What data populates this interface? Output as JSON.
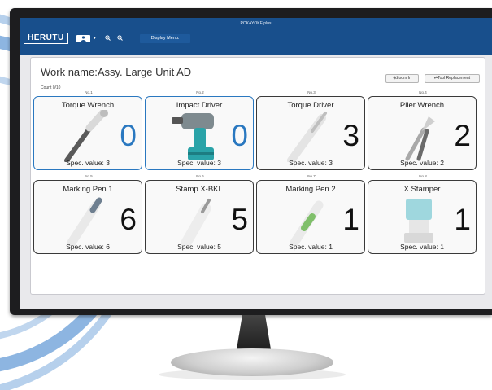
{
  "app": {
    "title": "POKAYOKE plus",
    "logo": "HERUTU"
  },
  "toolbar": {
    "user_icon": "user-icon",
    "caret": "▼",
    "zoom_in_glyph": "⊕",
    "zoom_out_glyph": "⊖",
    "display_menu_label": "Display Menu."
  },
  "work": {
    "name": "Work name:Assy. Large Unit AD",
    "count": "Count 0/10"
  },
  "buttons": {
    "zoom_in": "⊕Zoom In",
    "tool_replacement": "⇄Tool Replacement"
  },
  "tools": [
    {
      "no": "No.1",
      "name": "Torque Wrench",
      "count": "0",
      "spec": "Spec. value: 3",
      "status": "done",
      "icon": "torque-wrench-icon"
    },
    {
      "no": "No.2",
      "name": "Impact Driver",
      "count": "0",
      "spec": "Spec. value: 3",
      "status": "done",
      "icon": "impact-driver-icon"
    },
    {
      "no": "No.3",
      "name": "Torque Driver",
      "count": "3",
      "spec": "Spec. value: 3",
      "status": "pending",
      "icon": "torque-driver-icon"
    },
    {
      "no": "No.4",
      "name": "Plier Wrench",
      "count": "2",
      "spec": "Spec. value: 2",
      "status": "pending",
      "icon": "plier-wrench-icon"
    },
    {
      "no": "No.5",
      "name": "Marking Pen 1",
      "count": "6",
      "spec": "Spec. value: 6",
      "status": "pending",
      "icon": "marking-pen-icon"
    },
    {
      "no": "No.6",
      "name": "Stamp X-BKL",
      "count": "5",
      "spec": "Spec. value: 5",
      "status": "pending",
      "icon": "stamp-icon"
    },
    {
      "no": "No.7",
      "name": "Marking Pen 2",
      "count": "1",
      "spec": "Spec. value: 1",
      "status": "pending",
      "icon": "marking-pen-icon"
    },
    {
      "no": "No.8",
      "name": "X Stamper",
      "count": "1",
      "spec": "Spec. value: 1",
      "status": "pending",
      "icon": "stamper-icon"
    }
  ],
  "colors": {
    "appbar": "#184f8c",
    "done_border": "#2a78c0",
    "pending_border": "#3a3a3a"
  }
}
